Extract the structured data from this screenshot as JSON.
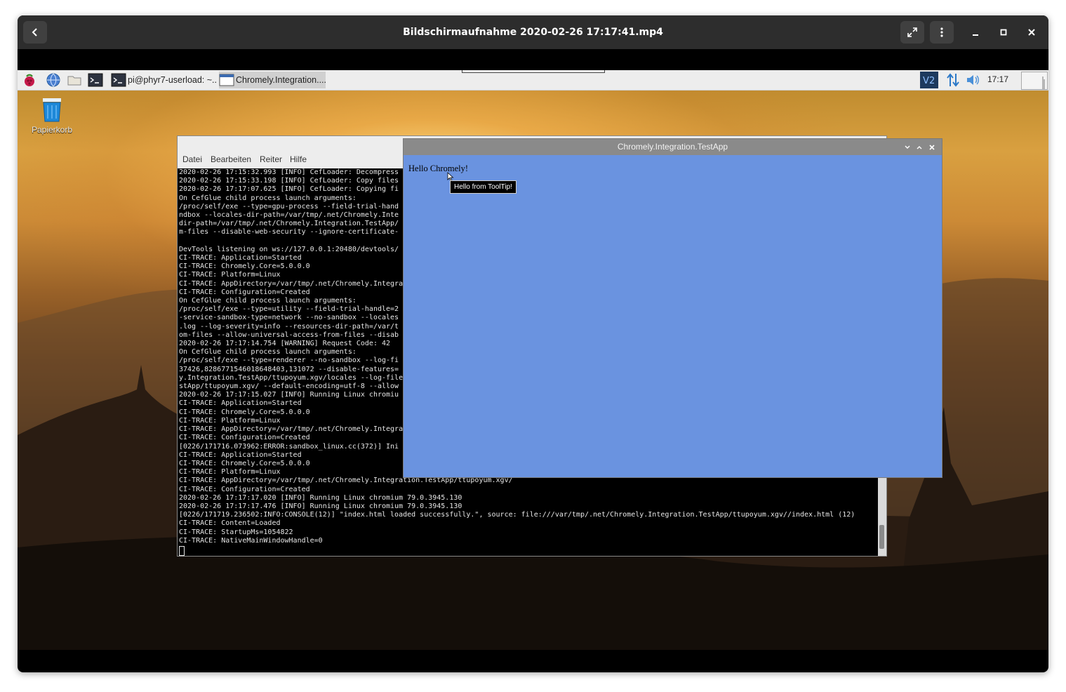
{
  "player": {
    "title": "Bildschirmaufnahme 2020-02-26 17:17:41.mp4",
    "back_icon": "back-arrow-icon",
    "fullscreen_icon": "fullscreen-icon",
    "menu_icon": "kebab-menu-icon"
  },
  "taskbar": {
    "launcher_icons": [
      "raspberry-menu-icon",
      "web-browser-icon",
      "file-manager-icon",
      "terminal-icon"
    ],
    "tasks": [
      {
        "label": "pi@phyr7-userload: ~...",
        "icon": "terminal-icon"
      },
      {
        "label": "Chromely.Integration....",
        "icon": "window-icon"
      }
    ],
    "tray_icons": [
      "vnc-icon",
      "network-icon",
      "volume-icon",
      "cpu-monitor-icon"
    ],
    "clock": "17:17"
  },
  "desktop": {
    "trash_label": "Papierkorb"
  },
  "terminal": {
    "menu": [
      "Datei",
      "Bearbeiten",
      "Reiter",
      "Hilfe"
    ],
    "lines": [
      "2020-02-26 17:15:32.993 [INFO] CefLoader: Decompress",
      "2020-02-26 17:15:33.198 [INFO] CefLoader: Copy files",
      "2020-02-26 17:17:07.625 [INFO] CefLoader: Copying fi",
      "On CefGlue child process launch arguments:",
      "/proc/self/exe --type=gpu-process --field-trial-hand",
      "ndbox --locales-dir-path=/var/tmp/.net/Chromely.Inte",
      "dir-path=/var/tmp/.net/Chromely.Integration.TestApp/",
      "m-files --disable-web-security --ignore-certificate-",
      "",
      "DevTools listening on ws://127.0.0.1:20480/devtools/",
      "CI-TRACE: Application=Started",
      "CI-TRACE: Chromely.Core=5.0.0.0",
      "CI-TRACE: Platform=Linux",
      "CI-TRACE: AppDirectory=/var/tmp/.net/Chromely.Integra",
      "CI-TRACE: Configuration=Created",
      "On CefGlue child process launch arguments:",
      "/proc/self/exe --type=utility --field-trial-handle=2",
      "-service-sandbox-type=network --no-sandbox --locales",
      ".log --log-severity=info --resources-dir-path=/var/t",
      "om-files --allow-universal-access-from-files --disab",
      "2020-02-26 17:17:14.754 [WARNING] Request Code: 42",
      "On CefGlue child process launch arguments:",
      "/proc/self/exe --type=renderer --no-sandbox --log-fi",
      "37426,8286771546018648403,131072 --disable-features=",
      "y.Integration.TestApp/ttupoyum.xgv/locales --log-file",
      "stApp/ttupoyum.xgv/ --default-encoding=utf-8 --allow",
      "2020-02-26 17:17:15.027 [INFO] Running Linux chromiu",
      "CI-TRACE: Application=Started",
      "CI-TRACE: Chromely.Core=5.0.0.0",
      "CI-TRACE: Platform=Linux",
      "CI-TRACE: AppDirectory=/var/tmp/.net/Chromely.Integra",
      "CI-TRACE: Configuration=Created",
      "[0226/171716.073962:ERROR:sandbox_linux.cc(372)] Ini",
      "CI-TRACE: Application=Started",
      "CI-TRACE: Chromely.Core=5.0.0.0",
      "CI-TRACE: Platform=Linux",
      "CI-TRACE: AppDirectory=/var/tmp/.net/Chromely.Integration.TestApp/ttupoyum.xgv/",
      "CI-TRACE: Configuration=Created",
      "2020-02-26 17:17:17.020 [INFO] Running Linux chromium 79.0.3945.130",
      "2020-02-26 17:17:17.476 [INFO] Running Linux chromium 79.0.3945.130",
      "[0226/171719.236502:INFO:CONSOLE(12)] \"index.html loaded successfully.\", source: file:///var/tmp/.net/Chromely.Integration.TestApp/ttupoyum.xgv//index.html (12)",
      "CI-TRACE: Content=Loaded",
      "CI-TRACE: StartupMs=1054822",
      "CI-TRACE: NativeMainWindowHandle=0"
    ]
  },
  "app": {
    "title": "Chromely.Integration.TestApp",
    "hello": "Hello Chromely!",
    "tooltip": "Hello from ToolTip!",
    "background": "#6a93e0"
  }
}
